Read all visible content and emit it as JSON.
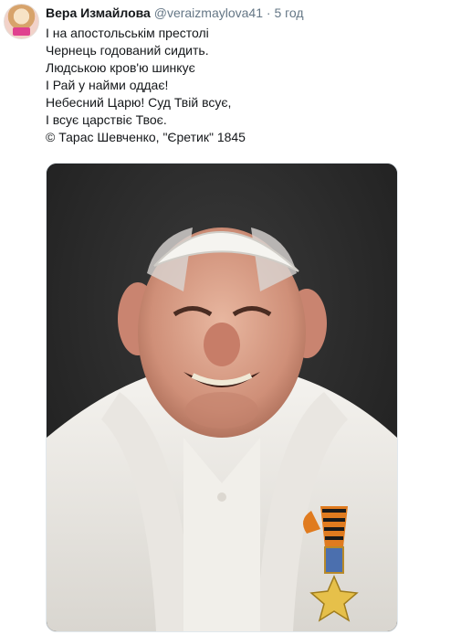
{
  "tweet": {
    "author_name": "Вера Измайлова",
    "author_handle": "@veraizmaylova41",
    "separator": "·",
    "timestamp": "5 год",
    "lines": [
      "І на апостольськім престолі",
      "Чернець годований сидить.",
      "Людською кров'ю шинкує",
      "І Рай у найми оддає!",
      "Небесний Царю! Суд Твій всує,",
      "І всує царствіє Твоє.",
      "© Тарас Шевченко, \"Єретик\" 1845"
    ]
  },
  "media": {
    "description_icon": "portrait-illustration"
  },
  "colors": {
    "text": "#14171a",
    "secondary": "#657786",
    "background": "#ffffff"
  }
}
